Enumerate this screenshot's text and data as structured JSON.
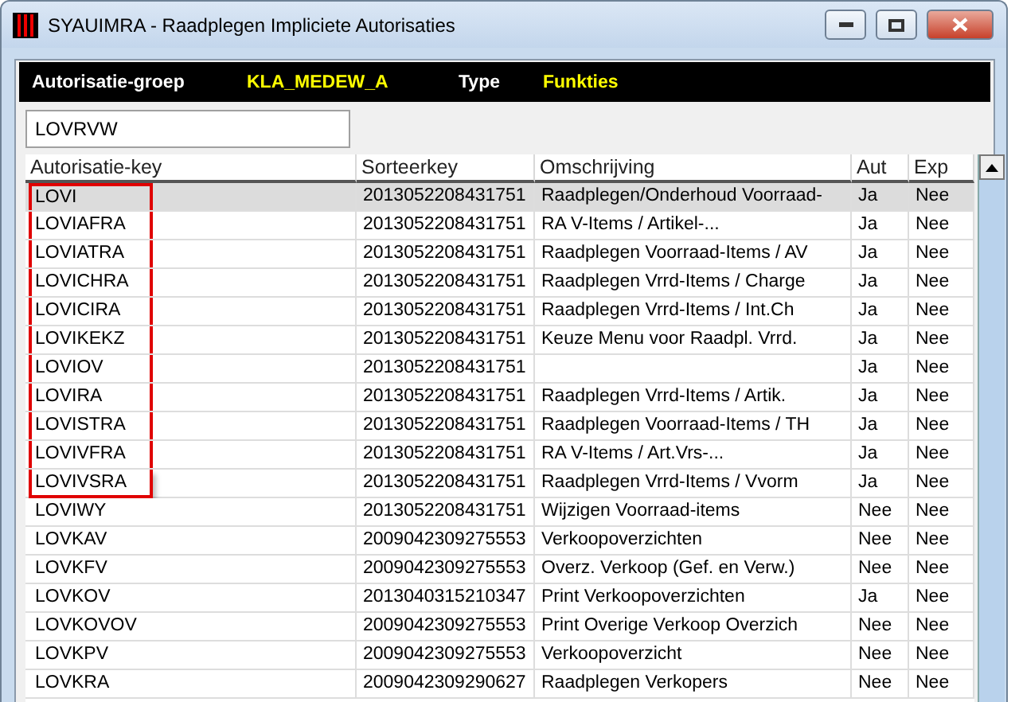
{
  "window": {
    "title": "SYAUIMRA - Raadplegen Impliciete Autorisaties"
  },
  "header": {
    "group_label": "Autorisatie-groep",
    "group_value": "KLA_MEDEW_A",
    "type_label": "Type",
    "type_value": "Funkties"
  },
  "search": {
    "value": "LOVRVW"
  },
  "table": {
    "columns": [
      "Autorisatie-key",
      "Sorteerkey",
      "Omschrijving",
      "Aut",
      "Exp"
    ],
    "rows": [
      {
        "cells": [
          "LOVI",
          "2013052208431751",
          "Raadplegen/Onderhoud Voorraad-",
          "Ja",
          "Nee"
        ],
        "selected": true,
        "marked": true
      },
      {
        "cells": [
          "LOVIAFRA",
          "2013052208431751",
          "RA V-Items / Artikel-...",
          "Ja",
          "Nee"
        ],
        "selected": false,
        "marked": true
      },
      {
        "cells": [
          "LOVIATRA",
          "2013052208431751",
          "Raadplegen Voorraad-Items / AV",
          "Ja",
          "Nee"
        ],
        "selected": false,
        "marked": true
      },
      {
        "cells": [
          "LOVICHRA",
          "2013052208431751",
          "Raadplegen Vrrd-Items / Charge",
          "Ja",
          "Nee"
        ],
        "selected": false,
        "marked": true
      },
      {
        "cells": [
          "LOVICIRA",
          "2013052208431751",
          "Raadplegen Vrrd-Items / Int.Ch",
          "Ja",
          "Nee"
        ],
        "selected": false,
        "marked": true
      },
      {
        "cells": [
          "LOVIKEKZ",
          "2013052208431751",
          "Keuze Menu voor Raadpl. Vrrd.",
          "Ja",
          "Nee"
        ],
        "selected": false,
        "marked": true
      },
      {
        "cells": [
          "LOVIOV",
          "2013052208431751",
          "",
          "Ja",
          "Nee"
        ],
        "selected": false,
        "marked": true
      },
      {
        "cells": [
          "LOVIRA",
          "2013052208431751",
          "Raadplegen Vrrd-Items / Artik.",
          "Ja",
          "Nee"
        ],
        "selected": false,
        "marked": true
      },
      {
        "cells": [
          "LOVISTRA",
          "2013052208431751",
          "Raadplegen Voorraad-Items / TH",
          "Ja",
          "Nee"
        ],
        "selected": false,
        "marked": true
      },
      {
        "cells": [
          "LOVIVFRA",
          "2013052208431751",
          "RA V-Items / Art.Vrs-...",
          "Ja",
          "Nee"
        ],
        "selected": false,
        "marked": true
      },
      {
        "cells": [
          "LOVIVSRA",
          "2013052208431751",
          "Raadplegen Vrrd-Items / Vvorm",
          "Ja",
          "Nee"
        ],
        "selected": false,
        "marked": true
      },
      {
        "cells": [
          "LOVIWY",
          "2013052208431751",
          "Wijzigen Voorraad-items",
          "Nee",
          "Nee"
        ],
        "selected": false,
        "marked": false
      },
      {
        "cells": [
          "LOVKAV",
          "2009042309275553",
          "Verkoopoverzichten",
          "Nee",
          "Nee"
        ],
        "selected": false,
        "marked": false
      },
      {
        "cells": [
          "LOVKFV",
          "2009042309275553",
          "Overz. Verkoop (Gef. en Verw.)",
          "Nee",
          "Nee"
        ],
        "selected": false,
        "marked": false
      },
      {
        "cells": [
          "LOVKOV",
          "2013040315210347",
          "Print Verkoopoverzichten",
          "Ja",
          "Nee"
        ],
        "selected": false,
        "marked": false
      },
      {
        "cells": [
          "LOVKOVOV",
          "2009042309275553",
          "Print Overige Verkoop Overzich",
          "Nee",
          "Nee"
        ],
        "selected": false,
        "marked": false
      },
      {
        "cells": [
          "LOVKPV",
          "2009042309275553",
          "Verkoopoverzicht",
          "Nee",
          "Nee"
        ],
        "selected": false,
        "marked": false
      },
      {
        "cells": [
          "LOVKRA",
          "2009042309290627",
          "Raadplegen Verkopers",
          "Nee",
          "Nee"
        ],
        "selected": false,
        "marked": false
      }
    ]
  }
}
